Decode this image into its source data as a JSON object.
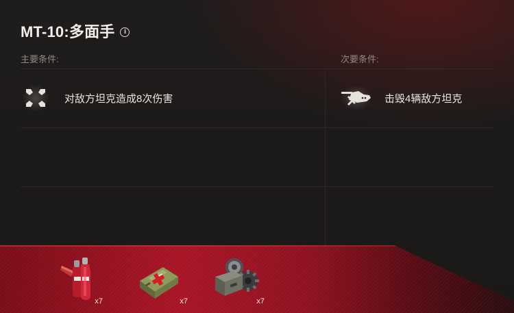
{
  "mission": {
    "title": "MT-10:多面手",
    "info_icon": "info-icon"
  },
  "primary": {
    "label": "主要条件:",
    "conditions": [
      {
        "icon": "crosshair-damage-icon",
        "text": "对敌方坦克造成8次伤害"
      }
    ]
  },
  "secondary": {
    "label": "次要条件:",
    "conditions": [
      {
        "icon": "tank-destroyed-icon",
        "text": "击毁4辆敌方坦克"
      }
    ]
  },
  "rewards": [
    {
      "name": "fire-extinguisher-icon",
      "count": "x7"
    },
    {
      "name": "first-aid-kit-icon",
      "count": "x7"
    },
    {
      "name": "repair-kit-icon",
      "count": "x7"
    }
  ],
  "colors": {
    "accent": "#a81526",
    "background": "#1c1a19"
  }
}
